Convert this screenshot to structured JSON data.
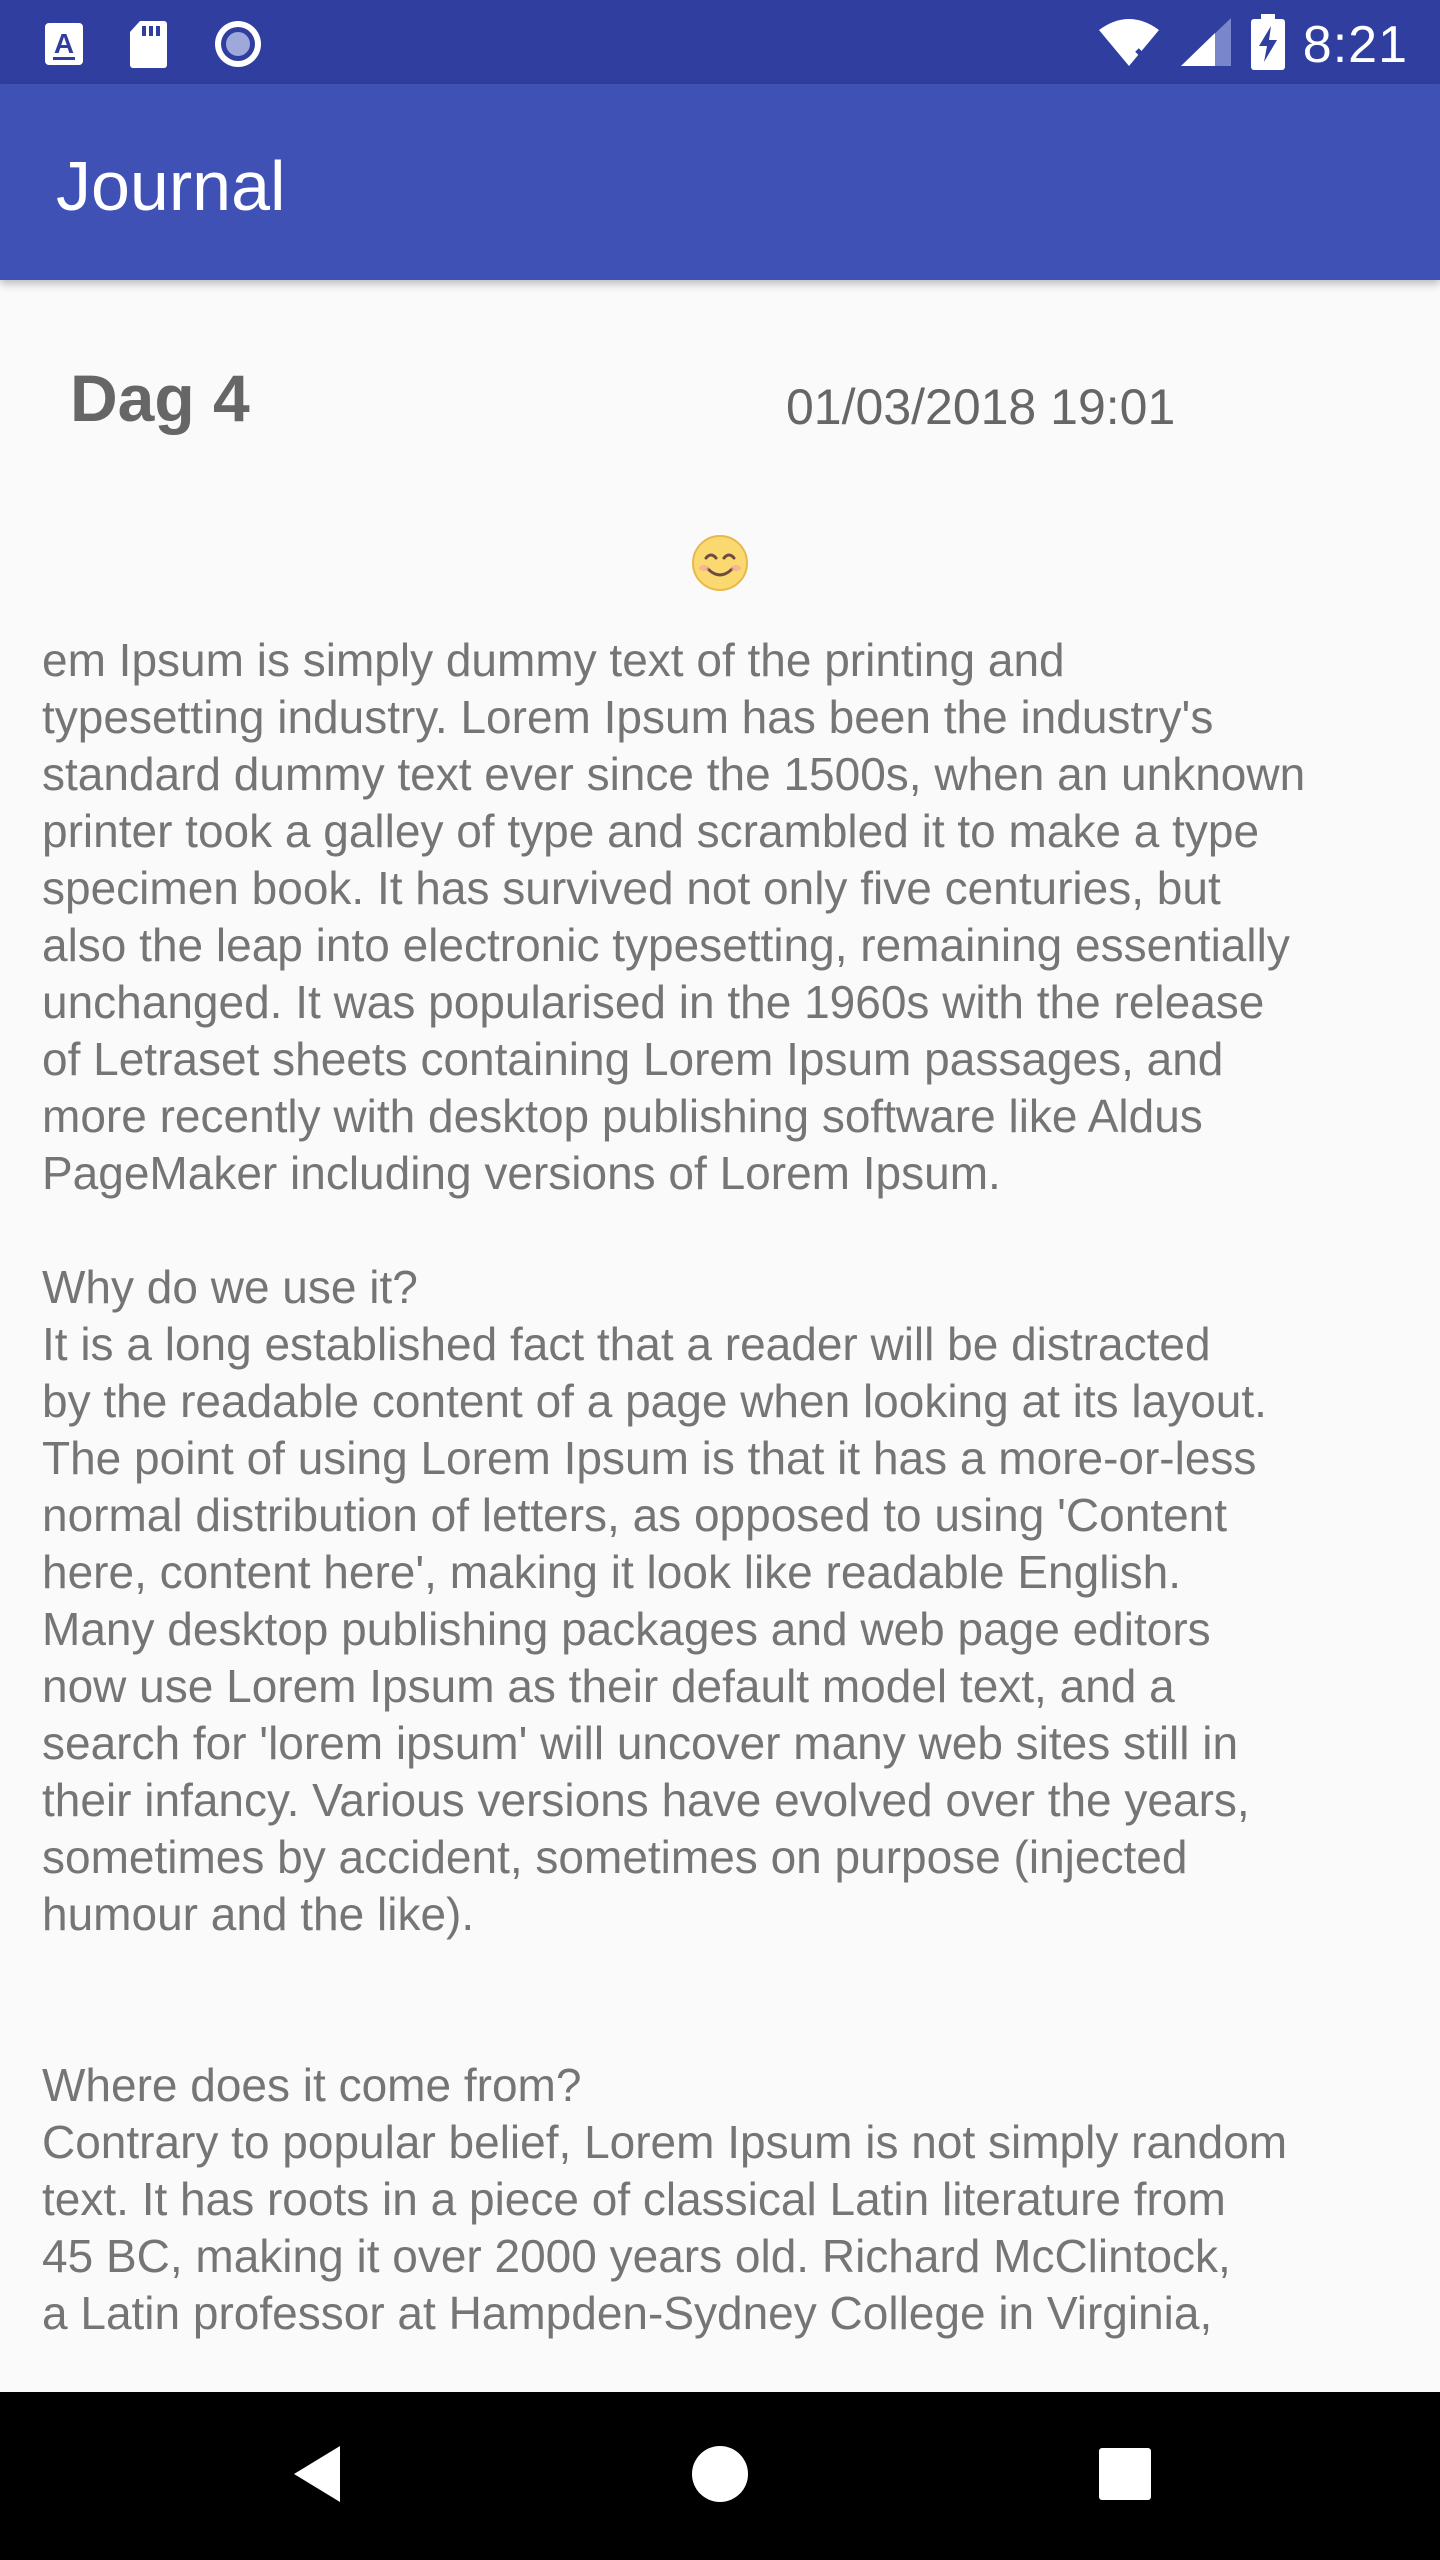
{
  "status_bar": {
    "left_icons": [
      "text-a-notification-icon",
      "sd-card-icon",
      "record-icon"
    ],
    "right_icons": [
      "wifi-icon",
      "signal-icon",
      "battery-charging-icon"
    ],
    "time": "8:21"
  },
  "app_bar": {
    "title": "Journal"
  },
  "entry": {
    "title": "Dag 4",
    "date": "01/03/2018 19:01",
    "mood_icon": "smiling-face-emoji",
    "body": "em Ipsum is simply dummy text of the printing and\ntypesetting industry. Lorem Ipsum has been the industry's\nstandard dummy text ever since the 1500s, when an unknown\nprinter took a galley of type and scrambled it to make a type\nspecimen book. It has survived not only five centuries, but\nalso the leap into electronic typesetting, remaining essentially\nunchanged. It was popularised in the 1960s with the release\nof Letraset sheets containing Lorem Ipsum passages, and\nmore recently with desktop publishing software like Aldus\nPageMaker including versions of Lorem Ipsum.\n\nWhy do we use it?\nIt is a long established fact that a reader will be distracted\nby the readable content of a page when looking at its layout.\nThe point of using Lorem Ipsum is that it has a more-or-less\nnormal distribution of letters, as opposed to using 'Content\nhere, content here', making it look like readable English.\nMany desktop publishing packages and web page editors\nnow use Lorem Ipsum as their default model text, and a\nsearch for 'lorem ipsum' will uncover many web sites still in\ntheir infancy. Various versions have evolved over the years,\nsometimes by accident, sometimes on purpose (injected\nhumour and the like).\n\n\nWhere does it come from?\nContrary to popular belief, Lorem Ipsum is not simply random\ntext. It has roots in a piece of classical Latin literature from\n45 BC, making it over 2000 years old. Richard McClintock,\na Latin professor at Hampden-Sydney College in Virginia,"
  },
  "nav_bar": {
    "buttons": [
      "back-icon",
      "home-icon",
      "recents-icon"
    ]
  },
  "colors": {
    "status_bar": "#303f9f",
    "app_bar": "#3f51b5",
    "background": "#fafafa",
    "text": "#757575",
    "nav_bar": "#000000"
  }
}
